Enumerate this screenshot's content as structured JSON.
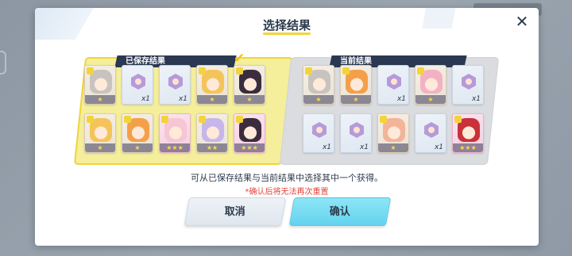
{
  "dialog": {
    "title": "选择结果",
    "close_icon": "close-icon",
    "saved_tag": "已保存结果",
    "current_tag": "当前结果",
    "description": "可从已保存结果与当前结果中选择其中一个获得。",
    "warning": "*确认后将无法再次重置",
    "cancel_label": "取消",
    "confirm_label": "确认"
  },
  "saved_cards": [
    {
      "kind": "character",
      "hair": "gray",
      "stars": "★"
    },
    {
      "kind": "item",
      "qty": "x1"
    },
    {
      "kind": "item",
      "qty": "x1"
    },
    {
      "kind": "character",
      "hair": "blonde",
      "stars": "★"
    },
    {
      "kind": "character",
      "hair": "dark",
      "stars": "★"
    },
    {
      "kind": "character",
      "hair": "blonde",
      "stars": "★"
    },
    {
      "kind": "character",
      "hair": "orange",
      "stars": "★"
    },
    {
      "kind": "character",
      "hair": "lightpink",
      "stars": "★★★",
      "rarity": "r3"
    },
    {
      "kind": "character",
      "hair": "lilac",
      "stars": "★★"
    },
    {
      "kind": "character",
      "hair": "dark",
      "stars": "★★★",
      "rarity": "r3"
    }
  ],
  "current_cards": [
    {
      "kind": "character",
      "hair": "gray",
      "stars": "★"
    },
    {
      "kind": "character",
      "hair": "orange",
      "stars": "★"
    },
    {
      "kind": "item",
      "qty": "x1"
    },
    {
      "kind": "character",
      "hair": "pink",
      "stars": "★"
    },
    {
      "kind": "item",
      "qty": "x1"
    },
    {
      "kind": "item",
      "qty": "x1"
    },
    {
      "kind": "item",
      "qty": "x1"
    },
    {
      "kind": "character",
      "hair": "peach",
      "stars": "★"
    },
    {
      "kind": "item",
      "qty": "x1"
    },
    {
      "kind": "character",
      "hair": "red",
      "stars": "★★★",
      "rarity": "r3"
    }
  ],
  "colors": {
    "saved_panel": "#f5ee9a",
    "saved_border": "#f0d43a",
    "current_panel": "#dadcdf",
    "confirm_button": "#63d3ee",
    "warning_text": "#e2463b"
  }
}
